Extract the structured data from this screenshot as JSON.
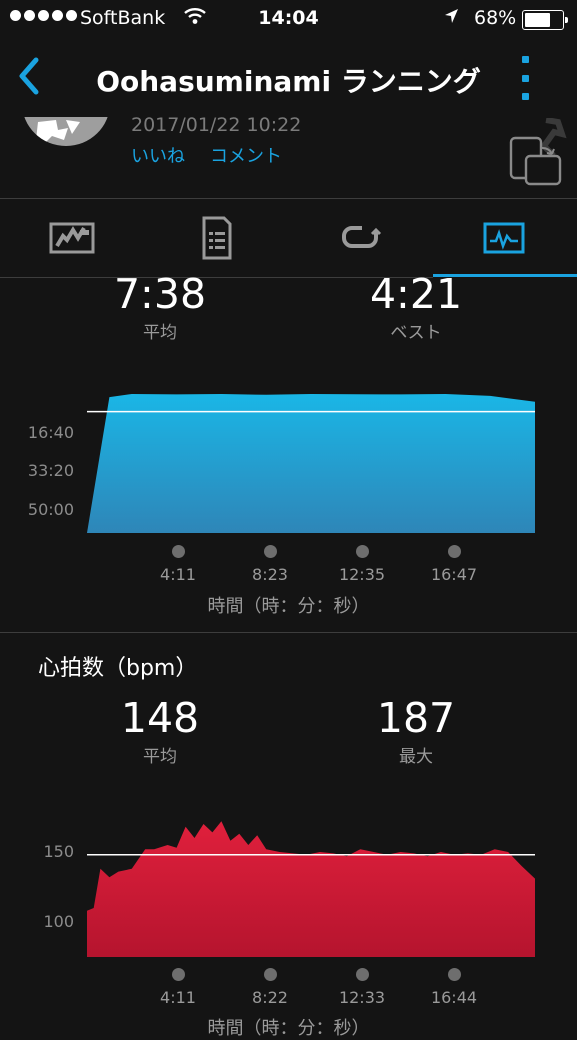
{
  "status_bar": {
    "carrier": "SoftBank",
    "time": "14:04",
    "battery": "68%",
    "battery_level": 0.68
  },
  "nav": {
    "title": "Oohasuminami ランニング",
    "back_icon": "chevron-left-icon",
    "more_icon": "vertical-ellipsis-icon",
    "accent_color": "#1aa3e0"
  },
  "activity": {
    "date": "2017/01/22 10:22",
    "like_label": "いいね",
    "comment_label": "コメント"
  },
  "tabs": [
    {
      "icon": "map-icon",
      "active": false
    },
    {
      "icon": "details-icon",
      "active": false
    },
    {
      "icon": "laps-icon",
      "active": false
    },
    {
      "icon": "charts-icon",
      "active": true
    }
  ],
  "pace": {
    "avg_value": "7:38",
    "avg_label": "平均",
    "best_value": "4:21",
    "best_label": "ベスト"
  },
  "heart_rate": {
    "heading": "心拍数（bpm）",
    "avg_value": "148",
    "avg_label": "平均",
    "max_value": "187",
    "max_label": "最大"
  },
  "chart_data": [
    {
      "type": "area",
      "color": "#1ab6e6",
      "ylim": [
        0,
        3600
      ],
      "y_inverted": true,
      "y_tick_labels": [
        "16:40",
        "33:20",
        "50:00"
      ],
      "y_ticks": [
        1000,
        2000,
        3000
      ],
      "reference_line": 458,
      "x_tick_labels": [
        "4:11",
        "8:23",
        "12:35",
        "16:47"
      ],
      "xlabel": "時間（時：分：秒）",
      "x": [
        0,
        1,
        2,
        4,
        6,
        8,
        10,
        12,
        14,
        16,
        18,
        20
      ],
      "values": [
        3600,
        80,
        0,
        10,
        0,
        20,
        0,
        5,
        10,
        0,
        50,
        200
      ]
    },
    {
      "type": "area",
      "color": "#e0203c",
      "ylim": [
        75,
        180
      ],
      "y_ticks": [
        100,
        150
      ],
      "reference_line": 148,
      "x_tick_labels": [
        "4:11",
        "8:22",
        "12:33",
        "16:44"
      ],
      "xlabel": "時間（時：分：秒）",
      "x": [
        0,
        0.3,
        0.6,
        1.0,
        1.4,
        2.0,
        2.6,
        3.0,
        3.6,
        4.0,
        4.4,
        4.8,
        5.2,
        5.6,
        6.0,
        6.4,
        6.8,
        7.2,
        7.6,
        8.0,
        8.6,
        9.2,
        9.8,
        10.4,
        11.0,
        11.6,
        12.2,
        12.8,
        13.4,
        14.0,
        14.6,
        15.2,
        15.8,
        16.4,
        17.0,
        17.6,
        18.2,
        18.8,
        19.4,
        20.0
      ],
      "values": [
        108,
        110,
        138,
        132,
        136,
        138,
        152,
        152,
        155,
        153,
        168,
        160,
        170,
        164,
        172,
        158,
        163,
        155,
        162,
        152,
        150,
        149,
        148,
        150,
        149,
        147,
        152,
        150,
        148,
        150,
        149,
        147,
        150,
        148,
        149,
        148,
        152,
        150,
        140,
        131
      ]
    }
  ]
}
